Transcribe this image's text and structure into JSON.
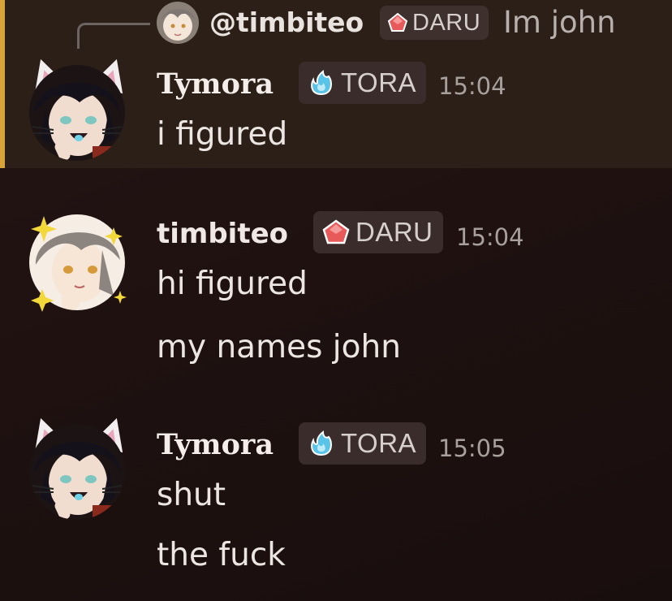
{
  "colors": {
    "background": "#1e1110",
    "highlight_background": "#2c1f18",
    "highlight_bar": "#d8a43a",
    "tag_background": "#3a2c2a",
    "tora_icon": "#59c3e8",
    "daru_icon": "#e85a5a"
  },
  "reply": {
    "mention": "@timbiteo",
    "tag": "DARU",
    "tag_icon": "red-crystal-icon",
    "text": "Im john"
  },
  "messages": [
    {
      "username": "Tymora",
      "tag": "TORA",
      "tag_icon": "blue-flame-icon",
      "time": "15:04",
      "lines": [
        "i figured"
      ],
      "highlighted": true
    },
    {
      "username": "timbiteo",
      "tag": "DARU",
      "tag_icon": "red-crystal-icon",
      "time": "15:04",
      "lines": [
        "hi figured",
        "my names john"
      ]
    },
    {
      "username": "Tymora",
      "tag": "TORA",
      "tag_icon": "blue-flame-icon",
      "time": "15:05",
      "lines": [
        "shut",
        "the fuck"
      ]
    }
  ]
}
